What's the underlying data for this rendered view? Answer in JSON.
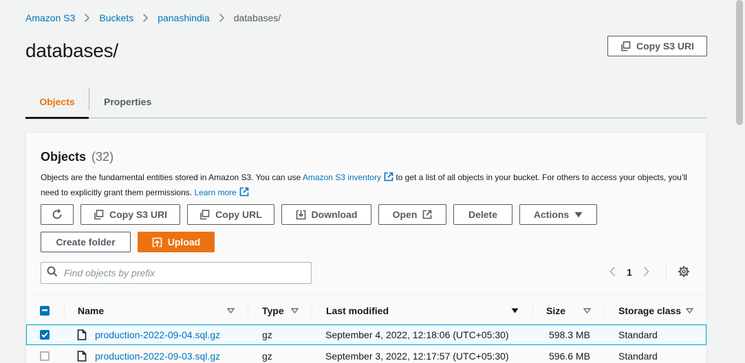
{
  "breadcrumb": {
    "items": [
      "Amazon S3",
      "Buckets",
      "panashindia",
      "databases/"
    ]
  },
  "page": {
    "title": "databases/",
    "copy_uri_label": "Copy S3 URI"
  },
  "tabs": [
    {
      "label": "Objects",
      "active": true
    },
    {
      "label": "Properties",
      "active": false
    }
  ],
  "objects_panel": {
    "title": "Objects",
    "count": "(32)",
    "description_part1": "Objects are the fundamental entities stored in Amazon S3. You can use ",
    "inventory_link": "Amazon S3 inventory",
    "description_part2": " to get a list of all objects in your bucket. For others to access your objects, you’ll need to explicitly grant them permissions. ",
    "learn_more": "Learn more"
  },
  "actions": {
    "refresh_icon": "refresh-icon",
    "copy_s3_uri": "Copy S3 URI",
    "copy_url": "Copy URL",
    "download": "Download",
    "open": "Open",
    "delete": "Delete",
    "actions": "Actions",
    "create_folder": "Create folder",
    "upload": "Upload"
  },
  "search": {
    "placeholder": "Find objects by prefix",
    "value": ""
  },
  "pagination": {
    "current_page": "1"
  },
  "table": {
    "columns": [
      "Name",
      "Type",
      "Last modified",
      "Size",
      "Storage class"
    ],
    "rows": [
      {
        "name": "production-2022-09-04.sql.gz",
        "type": "gz",
        "last_modified": "September 4, 2022, 12:18:06 (UTC+05:30)",
        "size": "598.3 MB",
        "storage_class": "Standard",
        "selected": true
      },
      {
        "name": "production-2022-09-03.sql.gz",
        "type": "gz",
        "last_modified": "September 3, 2022, 12:17:57 (UTC+05:30)",
        "size": "596.6 MB",
        "storage_class": "Standard",
        "selected": false
      }
    ]
  },
  "colors": {
    "link": "#0073bb",
    "primary": "#ec7211",
    "text": "#16191f",
    "border": "#aab7b8",
    "selected_row_border": "#00a1c9"
  }
}
